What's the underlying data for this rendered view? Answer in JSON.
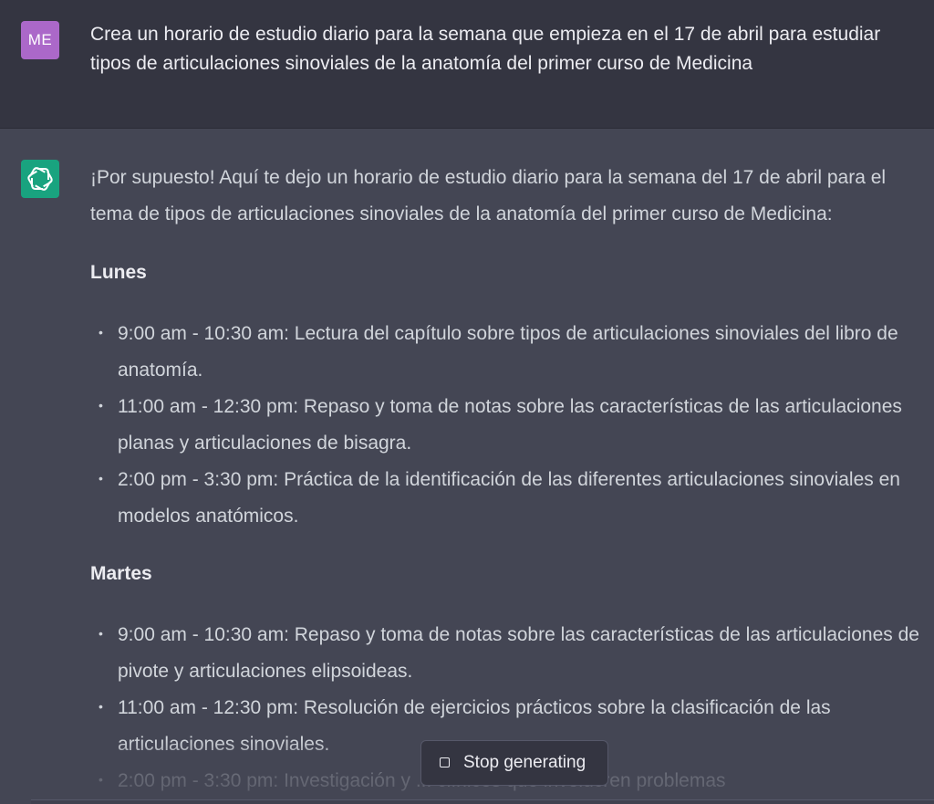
{
  "user": {
    "avatar_initials": "ME",
    "message": "Crea un horario de estudio diario para la semana que empieza en el 17 de abril para estudiar tipos de articulaciones sinoviales de la anatomía del primer curso de Medicina"
  },
  "assistant": {
    "intro": "¡Por supuesto! Aquí te dejo un horario de estudio diario para la semana del 17 de abril para el tema de tipos de articulaciones sinoviales de la anatomía del primer curso de Medicina:",
    "days": [
      {
        "name": "Lunes",
        "sessions": [
          "9:00 am - 10:30 am: Lectura del capítulo sobre tipos de articulaciones sinoviales del libro de anatomía.",
          "11:00 am - 12:30 pm: Repaso y toma de notas sobre las características de las articulaciones planas y articulaciones de bisagra.",
          "2:00 pm - 3:30 pm: Práctica de la identificación de las diferentes articulaciones sinoviales en modelos anatómicos."
        ]
      },
      {
        "name": "Martes",
        "sessions": [
          "9:00 am - 10:30 am: Repaso y toma de notas sobre las características de las articulaciones de pivote y articulaciones elipsoideas.",
          "11:00 am - 12:30 pm: Resolución de ejercicios prácticos sobre la clasificación de las articulaciones sinoviales.",
          "2:00 pm - 3:30 pm: Investigación y ... clínicos que involucren problemas"
        ]
      }
    ]
  },
  "controls": {
    "stop_label": "Stop generating"
  },
  "colors": {
    "user_bg": "#343541",
    "assistant_bg": "#444654",
    "user_avatar": "#ab68c9",
    "bot_avatar": "#19a37f"
  },
  "icons": {
    "user_avatar": "user-avatar",
    "bot_avatar": "openai-logo-icon",
    "stop": "stop-square-icon"
  }
}
